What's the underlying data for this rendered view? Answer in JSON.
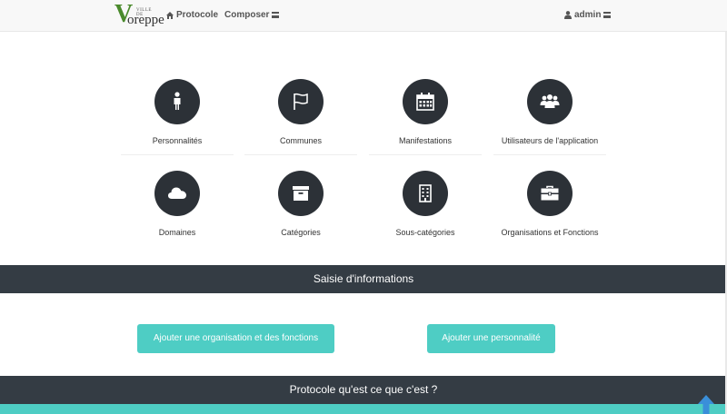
{
  "navbar": {
    "logo_small": "VILLE DE",
    "logo_letter": "V",
    "logo_word": "oreppe",
    "protocole": "Protocole",
    "composer": "Composer",
    "user": "admin"
  },
  "tiles": [
    {
      "label": "Personnalités",
      "icon": "person-icon"
    },
    {
      "label": "Communes",
      "icon": "flag-icon"
    },
    {
      "label": "Manifestations",
      "icon": "calendar-icon"
    },
    {
      "label": "Utilisateurs de l'application",
      "icon": "users-icon"
    },
    {
      "label": "Domaines",
      "icon": "cloud-icon"
    },
    {
      "label": "Catégories",
      "icon": "archive-icon"
    },
    {
      "label": "Sous-catégories",
      "icon": "building-icon"
    },
    {
      "label": "Organisations et Fonctions",
      "icon": "briefcase-icon"
    }
  ],
  "section1": {
    "title": "Saisie d'informations"
  },
  "buttons": {
    "add_org": "Ajouter une organisation et des fonctions",
    "add_person": "Ajouter une personnalité"
  },
  "section2": {
    "title": "Protocole qu'est ce que c'est ?"
  },
  "colors": {
    "accent": "#4ecdc4",
    "dark": "#343c44",
    "circle": "#2c3137"
  }
}
